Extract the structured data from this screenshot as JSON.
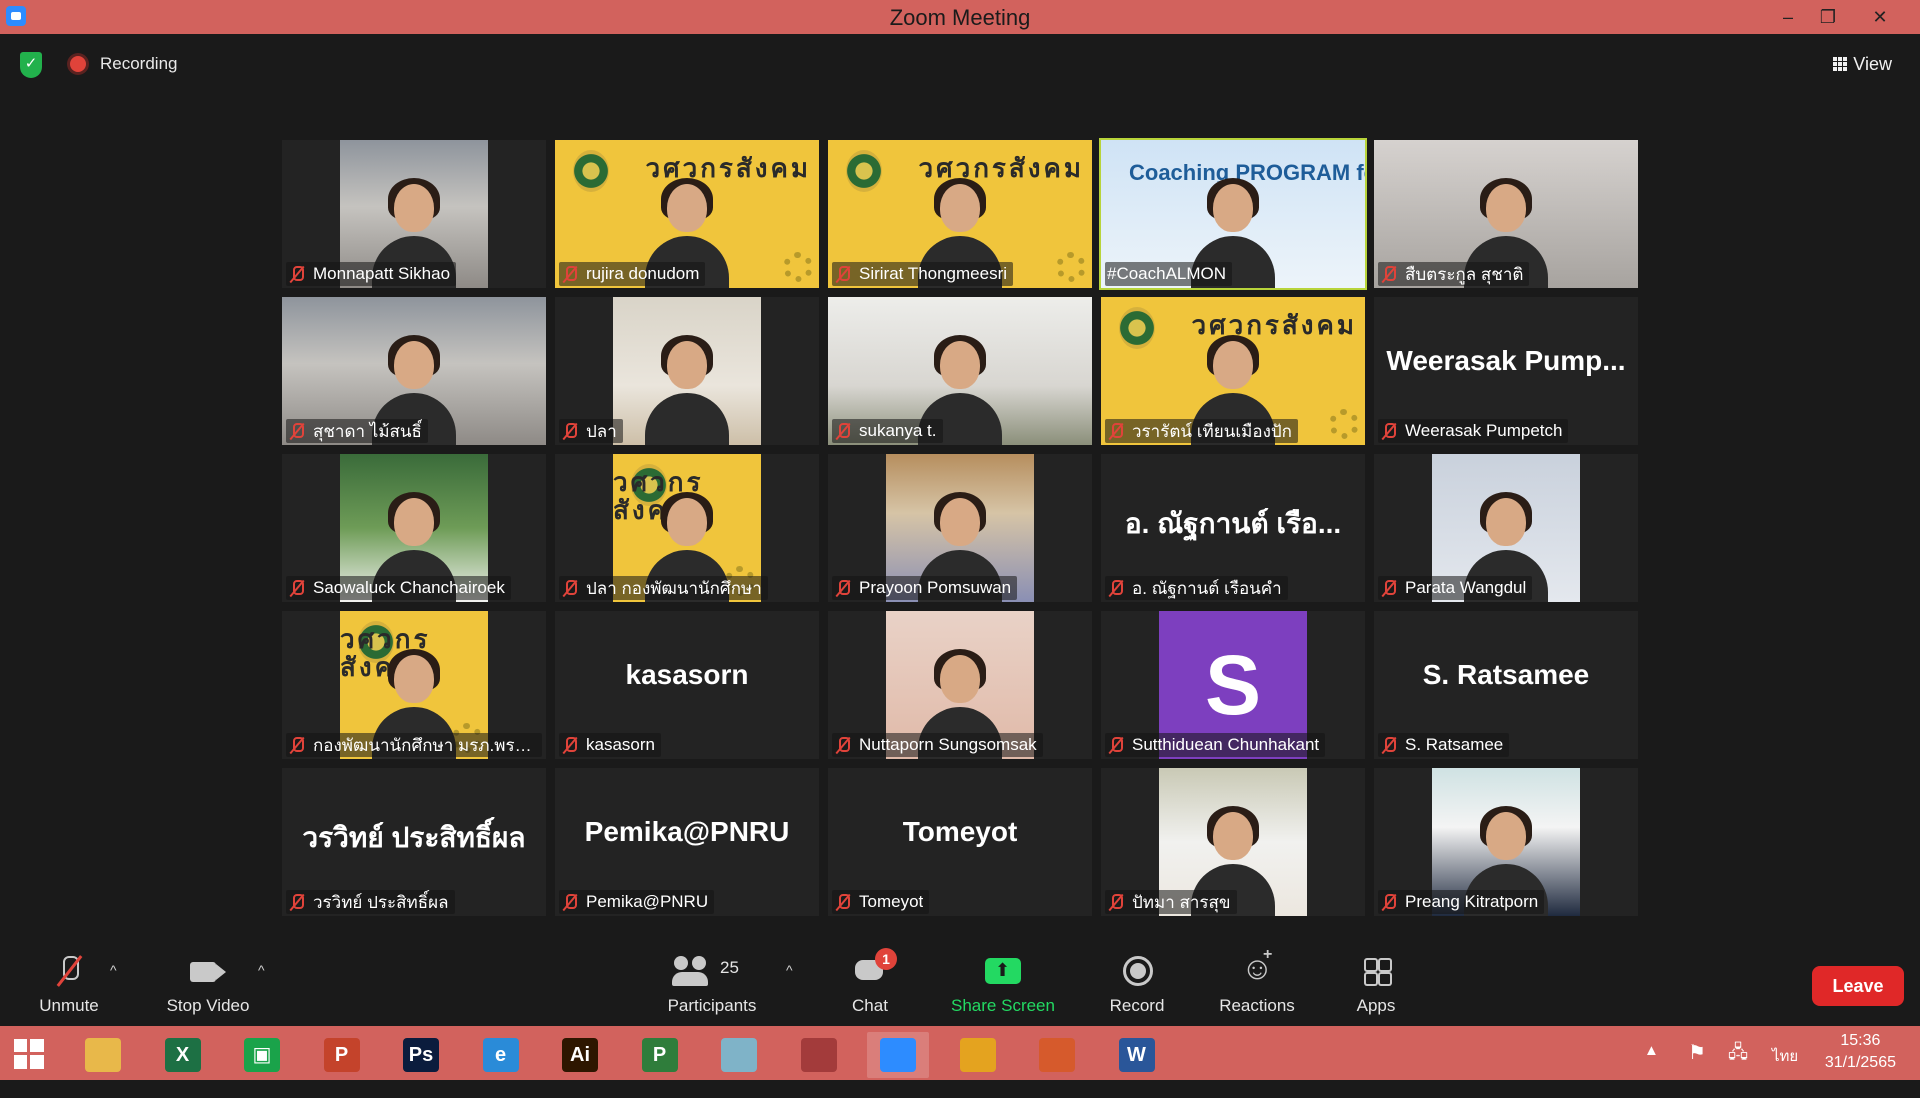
{
  "window": {
    "title": "Zoom Meeting",
    "minimize": "–",
    "restore": "❐",
    "close": "✕"
  },
  "topbar": {
    "security_icon": "shield-check-icon",
    "security_glyph": "✓",
    "recording_label": "Recording",
    "view_label": "View"
  },
  "tiles": [
    {
      "name": "Monnapatt Sikhao",
      "video": "photo-1",
      "muted": true
    },
    {
      "name": "rujira donudom",
      "video": "poster",
      "muted": true
    },
    {
      "name": "Sirirat Thongmeesri",
      "video": "poster",
      "muted": true
    },
    {
      "name": "#CoachALMON",
      "video": "coach",
      "muted": false,
      "active": true,
      "banner": "Coaching PROGRAM for Trainer"
    },
    {
      "name": "สืบตระกูล สุชาติ",
      "video": "photo-5",
      "muted": true
    },
    {
      "name": "สุชาดา ไม้สนธิ์",
      "video": "photo-1",
      "muted": true
    },
    {
      "name": "ปลา",
      "video": "photo-2",
      "muted": true
    },
    {
      "name": "sukanya t.",
      "video": "photo-3",
      "muted": true
    },
    {
      "name": "วรารัตน์ เทียนเมืองปัก",
      "video": "poster",
      "muted": true
    },
    {
      "name": "Weerasak Pumpetch",
      "video": "none",
      "display": "Weerasak  Pump...",
      "muted": true
    },
    {
      "name": "Saowaluck Chanchairoek",
      "video": "photo-4",
      "muted": true
    },
    {
      "name": "ปลา กองพัฒนานักศึกษา",
      "video": "poster",
      "muted": true
    },
    {
      "name": "Prayoon Pomsuwan",
      "video": "photo-6",
      "muted": true
    },
    {
      "name": "อ. ณัฐกานต์ เรือนคำ",
      "video": "none",
      "display": "อ. ณัฐกานต์  เรือ...",
      "muted": true
    },
    {
      "name": "Parata Wangdul",
      "video": "photo-10",
      "muted": true
    },
    {
      "name": "กองพัฒนานักศึกษา มรภ.พระนคร",
      "video": "poster",
      "muted": true
    },
    {
      "name": "kasasorn",
      "video": "none",
      "display": "kasasorn",
      "muted": true
    },
    {
      "name": "Nuttaporn Sungsomsak",
      "video": "photo-7",
      "muted": true
    },
    {
      "name": "Sutthiduean Chunhakant",
      "video": "avatar",
      "avatar_letter": "S",
      "muted": true
    },
    {
      "name": "S. Ratsamee",
      "video": "none",
      "display": "S. Ratsamee",
      "muted": true
    },
    {
      "name": "วรวิทย์ ประสิทธิ์ผล",
      "video": "none",
      "display": "วรวิทย์ ประสิทธิ์ผล",
      "muted": true
    },
    {
      "name": "Pemika@PNRU",
      "video": "none",
      "display": "Pemika@PNRU",
      "muted": true
    },
    {
      "name": "Tomeyot",
      "video": "none",
      "display": "Tomeyot",
      "muted": true
    },
    {
      "name": "ปัทมา สารสุข",
      "video": "photo-8",
      "muted": true
    },
    {
      "name": "Preang Kitratporn",
      "video": "photo-9",
      "muted": true
    }
  ],
  "poster_text": "วศวกรสังคม",
  "controls": {
    "unmute": "Unmute",
    "stop_video": "Stop Video",
    "participants": "Participants",
    "participants_count": "25",
    "chat": "Chat",
    "chat_badge": "1",
    "share_screen": "Share Screen",
    "record": "Record",
    "reactions": "Reactions",
    "apps": "Apps",
    "leave": "Leave",
    "caret": "^"
  },
  "taskbar": {
    "apps": [
      {
        "icon": "file-explorer-icon",
        "glyph": "",
        "color": "#e8b84a"
      },
      {
        "icon": "excel-icon",
        "glyph": "X",
        "color": "#1d7044"
      },
      {
        "icon": "store-icon",
        "glyph": "▣",
        "color": "#1aa34a"
      },
      {
        "icon": "powerpoint-icon",
        "glyph": "P",
        "color": "#c4432b"
      },
      {
        "icon": "photoshop-icon",
        "glyph": "Ps",
        "color": "#0b1c3d"
      },
      {
        "icon": "internet-explorer-icon",
        "glyph": "e",
        "color": "#2a8bd8"
      },
      {
        "icon": "illustrator-icon",
        "glyph": "Ai",
        "color": "#2e1600"
      },
      {
        "icon": "project-icon",
        "glyph": "P",
        "color": "#2f7d3b"
      },
      {
        "icon": "notepad-icon",
        "glyph": "",
        "color": "#7fb3c8"
      },
      {
        "icon": "photoscape-icon",
        "glyph": "",
        "color": "#a33b3b"
      },
      {
        "icon": "zoom-icon",
        "glyph": "",
        "color": "#2d8cff",
        "active": true
      },
      {
        "icon": "chrome-icon",
        "glyph": "",
        "color": "#e4a31f"
      },
      {
        "icon": "photos-icon",
        "glyph": "",
        "color": "#d65a2c"
      },
      {
        "icon": "word-icon",
        "glyph": "W",
        "color": "#2a5699"
      }
    ],
    "tray_up": "▲",
    "language": "ไทย",
    "time": "15:36",
    "date": "31/1/2565"
  }
}
